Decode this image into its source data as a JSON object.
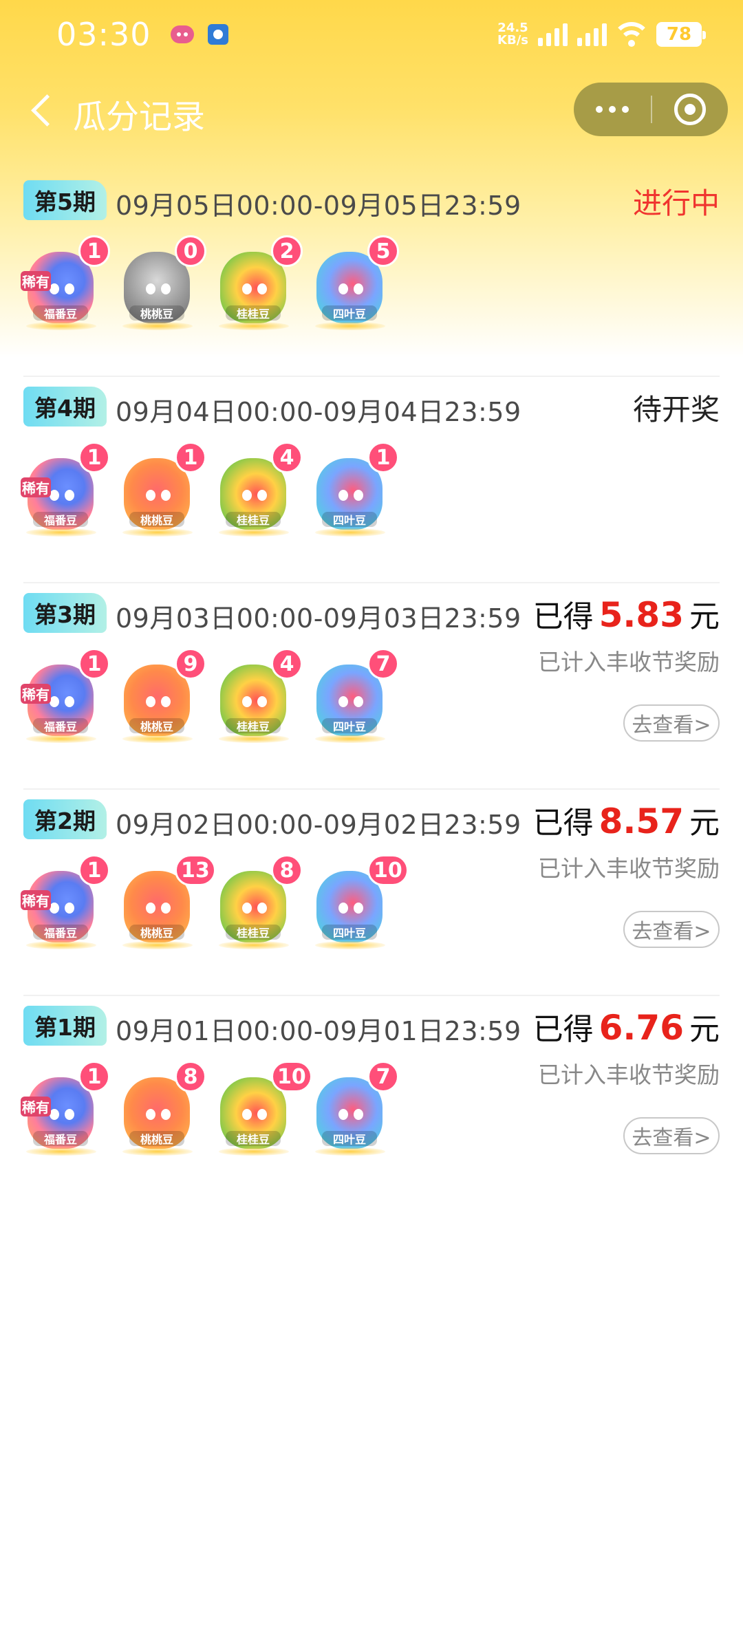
{
  "status_bar": {
    "time": "03:30",
    "net_speed_value": "24.5",
    "net_speed_unit": "KB/s",
    "battery": "78",
    "icons": [
      "chat-app-icon",
      "fish-app-icon",
      "signal-icon",
      "signal-icon",
      "wifi-icon",
      "battery-icon"
    ]
  },
  "nav": {
    "title": "瓜分记录",
    "back_icon": "chevron-left-icon",
    "more_icon": "more-dots-icon",
    "close_icon": "target-close-icon"
  },
  "records": [
    {
      "period": "第5期",
      "range": "09月05日00:00-09月05日23:59",
      "status": "进行中",
      "beans": [
        {
          "type": "rare",
          "tag": "稀有",
          "label": "福番豆",
          "count": "1"
        },
        {
          "type": "grey",
          "label": "桃桃豆",
          "count": "0"
        },
        {
          "type": "flower",
          "label": "桂桂豆",
          "count": "2"
        },
        {
          "type": "leaf",
          "label": "四叶豆",
          "count": "5"
        }
      ]
    },
    {
      "period": "第4期",
      "range": "09月04日00:00-09月04日23:59",
      "status": "待开奖",
      "beans": [
        {
          "type": "rare",
          "tag": "稀有",
          "label": "福番豆",
          "count": "1"
        },
        {
          "type": "peach",
          "label": "桃桃豆",
          "count": "1"
        },
        {
          "type": "flower",
          "label": "桂桂豆",
          "count": "4"
        },
        {
          "type": "leaf",
          "label": "四叶豆",
          "count": "1"
        }
      ]
    },
    {
      "period": "第3期",
      "range": "09月03日00:00-09月03日23:59",
      "earned_prefix": "已得",
      "amount": "5.83",
      "unit": "元",
      "note": "已计入丰收节奖励",
      "button": "去查看>",
      "beans": [
        {
          "type": "rare",
          "tag": "稀有",
          "label": "福番豆",
          "count": "1"
        },
        {
          "type": "peach",
          "label": "桃桃豆",
          "count": "9"
        },
        {
          "type": "flower",
          "label": "桂桂豆",
          "count": "4"
        },
        {
          "type": "leaf",
          "label": "四叶豆",
          "count": "7"
        }
      ]
    },
    {
      "period": "第2期",
      "range": "09月02日00:00-09月02日23:59",
      "earned_prefix": "已得",
      "amount": "8.57",
      "unit": "元",
      "note": "已计入丰收节奖励",
      "button": "去查看>",
      "beans": [
        {
          "type": "rare",
          "tag": "稀有",
          "label": "福番豆",
          "count": "1"
        },
        {
          "type": "peach",
          "label": "桃桃豆",
          "count": "13"
        },
        {
          "type": "flower",
          "label": "桂桂豆",
          "count": "8"
        },
        {
          "type": "leaf",
          "label": "四叶豆",
          "count": "10"
        }
      ]
    },
    {
      "period": "第1期",
      "range": "09月01日00:00-09月01日23:59",
      "earned_prefix": "已得",
      "amount": "6.76",
      "unit": "元",
      "note": "已计入丰收节奖励",
      "button": "去查看>",
      "beans": [
        {
          "type": "rare",
          "tag": "稀有",
          "label": "福番豆",
          "count": "1"
        },
        {
          "type": "peach",
          "label": "桃桃豆",
          "count": "8"
        },
        {
          "type": "flower",
          "label": "桂桂豆",
          "count": "10"
        },
        {
          "type": "leaf",
          "label": "四叶豆",
          "count": "7"
        }
      ]
    }
  ],
  "colors": {
    "accent_yellow": "#ffd84a",
    "status_red": "#f0342f",
    "amount_red": "#e8231b",
    "badge_pink": "#ff4f79",
    "tag_cyan": "#6fdcf2"
  }
}
